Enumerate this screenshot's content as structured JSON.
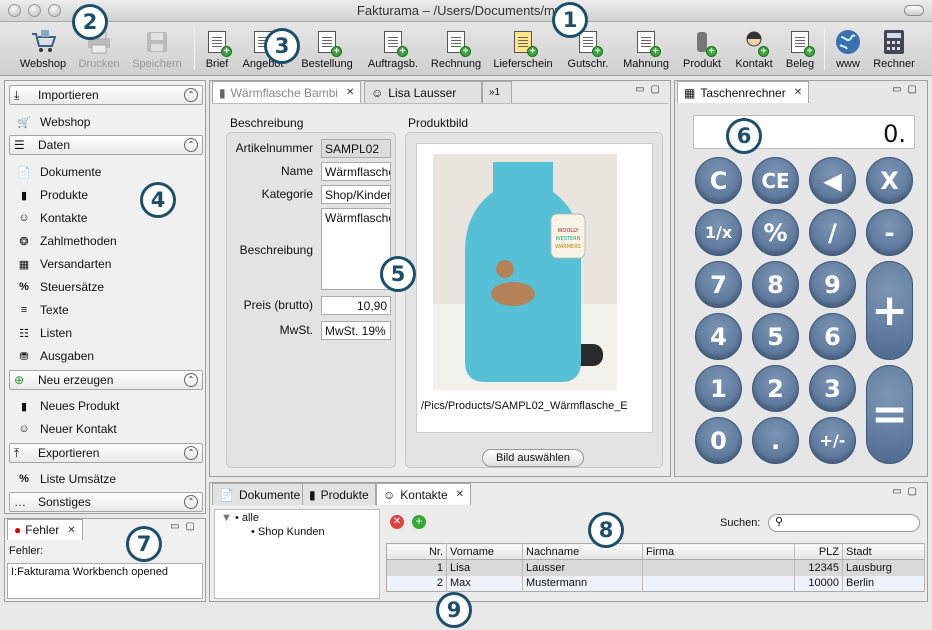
{
  "window": {
    "title": "Fakturama – /Users/Documents/myc2"
  },
  "toolbar": {
    "items": [
      {
        "label": "Webshop",
        "icon": "webshop-cart-icon",
        "enabled": true
      },
      {
        "label": "Drucken",
        "icon": "printer-icon",
        "enabled": false
      },
      {
        "label": "Speichern",
        "icon": "save-disk-icon",
        "enabled": false
      },
      {
        "label": "Brief",
        "icon": "new-letter-icon",
        "enabled": true
      },
      {
        "label": "Angebot",
        "icon": "new-offer-icon",
        "enabled": true
      },
      {
        "label": "Bestellung",
        "icon": "new-order-icon",
        "enabled": true
      },
      {
        "label": "Auftragsb.",
        "icon": "new-confirmation-icon",
        "enabled": true
      },
      {
        "label": "Rechnung",
        "icon": "new-invoice-icon",
        "enabled": true
      },
      {
        "label": "Lieferschein",
        "icon": "new-delivery-note-icon",
        "enabled": true
      },
      {
        "label": "Gutschr.",
        "icon": "new-credit-icon",
        "enabled": true
      },
      {
        "label": "Mahnung",
        "icon": "new-dunning-icon",
        "enabled": true
      },
      {
        "label": "Produkt",
        "icon": "new-product-icon",
        "enabled": true
      },
      {
        "label": "Kontakt",
        "icon": "new-contact-icon",
        "enabled": true
      },
      {
        "label": "Beleg",
        "icon": "new-receipt-icon",
        "enabled": true
      },
      {
        "label": "www",
        "icon": "globe-icon",
        "enabled": true
      },
      {
        "label": "Rechner",
        "icon": "calculator-icon",
        "enabled": true
      }
    ]
  },
  "sidebar": {
    "sections": [
      {
        "label": "Importieren",
        "items": [
          {
            "label": "Webshop"
          }
        ]
      },
      {
        "label": "Daten",
        "items": [
          {
            "label": "Dokumente"
          },
          {
            "label": "Produkte"
          },
          {
            "label": "Kontakte"
          },
          {
            "label": "Zahlmethoden"
          },
          {
            "label": "Versandarten"
          },
          {
            "label": "Steuersätze"
          },
          {
            "label": "Texte"
          },
          {
            "label": "Listen"
          },
          {
            "label": "Ausgaben"
          }
        ]
      },
      {
        "label": "Neu erzeugen",
        "items": [
          {
            "label": "Neues Produkt"
          },
          {
            "label": "Neuer Kontakt"
          }
        ]
      },
      {
        "label": "Exportieren",
        "items": [
          {
            "label": "Liste Umsätze"
          }
        ]
      },
      {
        "label": "Sonstiges",
        "items": []
      }
    ]
  },
  "errorview": {
    "tab": "Fehler",
    "label": "Fehler:",
    "text": "I:Fakturama Workbench opened"
  },
  "editor": {
    "tabs": [
      "Wärmflasche Bambi",
      "Lisa Lausser",
      "»1"
    ],
    "beschreibung_heading": "Beschreibung",
    "produktbild_heading": "Produktbild",
    "fields": {
      "artikelnummer_label": "Artikelnummer",
      "artikelnummer": "SAMPL02",
      "name_label": "Name",
      "name": "Wärmflasche",
      "kategorie_label": "Kategorie",
      "kategorie": "Shop/Kinder",
      "beschreibung_label": "Beschreibung",
      "beschreibung": "Wärmflasche",
      "preis_label": "Preis (brutto)",
      "preis": "10,90",
      "mwst_label": "MwSt.",
      "mwst": "MwSt. 19%"
    },
    "image_path": "/Pics/Products/SAMPL02_Wärmflasche_E",
    "image_button": "Bild auswählen",
    "image_text": "WOOLLY WESTERN WARMERS"
  },
  "calculator": {
    "tab": "Taschenrechner",
    "display": "0.",
    "keys": [
      "C",
      "CE",
      "◀",
      "X",
      "1/x",
      "%",
      "/",
      "-",
      "7",
      "8",
      "9",
      "+",
      "4",
      "5",
      "6",
      "1",
      "2",
      "3",
      "=",
      "0",
      ".",
      "+/-"
    ]
  },
  "bottom": {
    "tabs": [
      "Dokumente",
      "Produkte",
      "Kontakte"
    ],
    "tree": {
      "root": "alle",
      "child": "Shop Kunden"
    },
    "search_label": "Suchen:",
    "columns": [
      "Nr.",
      "Vorname",
      "Nachname",
      "Firma",
      "PLZ",
      "Stadt"
    ],
    "rows": [
      {
        "nr": "1",
        "vorname": "Lisa",
        "nachname": "Lausser",
        "firma": "",
        "plz": "12345",
        "stadt": "Lausburg"
      },
      {
        "nr": "2",
        "vorname": "Max",
        "nachname": "Mustermann",
        "firma": "",
        "plz": "10000",
        "stadt": "Berlin"
      }
    ]
  },
  "callouts": [
    "1",
    "2",
    "3",
    "4",
    "5",
    "6",
    "7",
    "8",
    "9"
  ]
}
